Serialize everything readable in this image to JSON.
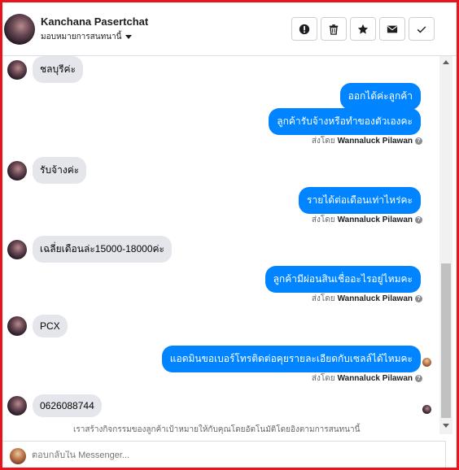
{
  "header": {
    "contact_name": "Kanchana Pasertchat",
    "assign_label": "มอบหมายการสนทนานี้",
    "toolbar": [
      {
        "icon": "alert-icon",
        "name": "mark-spam-button"
      },
      {
        "icon": "trash-icon",
        "name": "delete-button"
      },
      {
        "icon": "star-icon",
        "name": "follow-up-button"
      },
      {
        "icon": "mail-icon",
        "name": "mark-unread-button"
      },
      {
        "icon": "check-icon",
        "name": "mark-done-button"
      }
    ]
  },
  "messages": [
    {
      "dir": "in",
      "text": "ชลบุรีค่ะ"
    },
    {
      "dir": "out",
      "text": "ออกได้ค่ะลูกค้า"
    },
    {
      "dir": "out",
      "text": "ลูกค้ารับจ้างหรือทำของตัวเองคะ"
    },
    {
      "dir": "in",
      "text": "รับจ้างค่ะ"
    },
    {
      "dir": "out",
      "text": "รายได้ต่อเดือนเท่าไหร่คะ"
    },
    {
      "dir": "in",
      "text": "เฉลี่ยเดือนล่ะ15000-18000ค่ะ"
    },
    {
      "dir": "out",
      "text": "ลูกค้ามีผ่อนสินเชื่ออะไรอยู่ไหมคะ"
    },
    {
      "dir": "in",
      "text": "PCX"
    },
    {
      "dir": "out",
      "text": "แอดมินขอเบอร์โทรติดต่อคุยรายละเอียดกับเซลล์ได้ไหมคะ"
    },
    {
      "dir": "in",
      "text": "0626088744"
    }
  ],
  "sent_by": {
    "prefix": "ส่งโดย",
    "name": "Wannaluck Pilawan",
    "info_glyph": "?"
  },
  "footer_note": "เราสร้างกิจกรรมของลูกค้าเป้าหมายให้กับคุณโดยอัตโนมัติโดยอิงตามการสนทนานี้",
  "composer": {
    "placeholder": "ตอบกลับใน Messenger..."
  },
  "colors": {
    "outgoing_bubble": "#0084ff",
    "incoming_bubble": "#e4e6eb",
    "frame": "#e8141b"
  }
}
